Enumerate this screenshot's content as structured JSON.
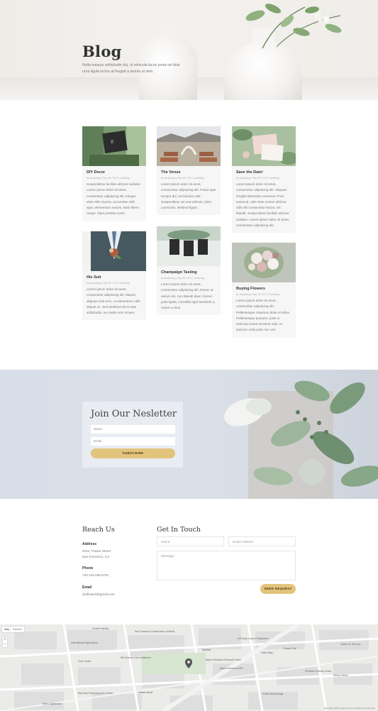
{
  "hero": {
    "title": "Blog",
    "subtitle": "Nulla tempus sollicitudin dui, ut vehicula lacus porta vel duis urna ligula luctus at feugiat a lacinia ut sem."
  },
  "posts": [
    {
      "title": "DIY Decor",
      "meta": "by benjuving | Sep 26, 2017 | wedding",
      "excerpt": "Suspendisse facilisis ultrices sodales. Lorem ipsum dolor sit amet, consectetur adipiscing elit. Integer vitae nibh viverra, accumsan nibh eget, elementum mauris. Nam libero neque. Nam porttitor tortor."
    },
    {
      "title": "The Venue",
      "meta": "by benjuving | Sep 26, 2017 | wedding",
      "excerpt": "Lorem ipsum dolor sit amet, consectetur adipiscing elit. Fusce quis tempor dui, sed lacinia velit. Suspendisse vel erat ultrices, dolor commodo, eleifend ligula."
    },
    {
      "title": "Save the Date!",
      "meta": "by benjuving | Sep 25, 2017 | wedding",
      "excerpt": "Lorem ipsum dolor sit amet, consectetur adipiscing elit. Aliquam fringilla bibendum euismod. Proin euismod, odio vitae cursus ultrices, nibh elit consectetur lectus, vel blandit. Suspendisse facilisis ultrices sodales. Lorem ipsum dolor sit amet, consectetur adipiscing elit."
    },
    {
      "title": "His Suit",
      "meta": "by benjuving | Sep 25, 2017 | wedding",
      "excerpt": "Lorem ipsum dolor sit amet, consectetur adipiscing elit. Mauris aliquam erat arcu, ut elementum nibh aliquet ac. Sed eleifend elit et ante sollicitudin, eu mattis eros ornare."
    },
    {
      "title": "Champaign Tasting",
      "meta": "by benjuving | Sep 26, 2017 | wedding",
      "excerpt": "Lorem ipsum dolor sit amet, consectetur adipiscing elit. Donec at varius nisi, non blandit diam. Donec justo ligula, convallis eget hendrerit a, varius a risus."
    },
    {
      "title": "Buying Flowers",
      "meta": "by benjuving | Sep 25, 2017 | wedding",
      "excerpt": "Lorem ipsum dolor sit amet, consectetur adipiscing elit. Pellentesque maximus dolor et tellus. Pellentesque posuere, justo in vehicula luctus tincidunt odio, et pulvinar nulla justo nec orci."
    }
  ],
  "newsletter": {
    "title": "Join Our Nesletter",
    "name_placeholder": "Name",
    "email_placeholder": "Email",
    "button": "SUBSCRIBE"
  },
  "reach": {
    "heading": "Reach Us",
    "address_label": "Address",
    "address_line1": "4044, Flower Street",
    "address_line2": "San Francisco, CA",
    "phone_label": "Phone",
    "phone": "+00 123.456.8754",
    "email_label": "Email",
    "email": "divifloweri@gmail.com"
  },
  "contact": {
    "heading": "Get In Touch",
    "name_placeholder": "Name",
    "email_placeholder": "Email Address",
    "message_placeholder": "Message",
    "button": "SEND REQUEST"
  },
  "map": {
    "tab_map": "Map",
    "tab_satellite": "Satellite",
    "labels": [
      "Cookie Hall Bar",
      "San Francisco Conservatory of Music",
      "International High School",
      "Civic Center",
      "Warfield",
      "Bill Graham Civic Auditorium",
      "Bank of America Financial Center",
      "Bank of America ATM",
      "US Army Corps of Engineers",
      "Hotel Nikko",
      "Flower Pole",
      "Center for Tax Law",
      "Kearny Street",
      "Bay Area Performing Arts Center",
      "Market Street",
      "SOMA Self Storage",
      "SOMArts Cultural Center",
      "Nick's Lighthouse"
    ],
    "footer": "Map data ©2017 Google   Terms of Use   Report a map error"
  },
  "colors": {
    "accent": "#e3c47c",
    "card_bg": "#f6f6f6",
    "newsletter_bg": "#d8dee7"
  }
}
